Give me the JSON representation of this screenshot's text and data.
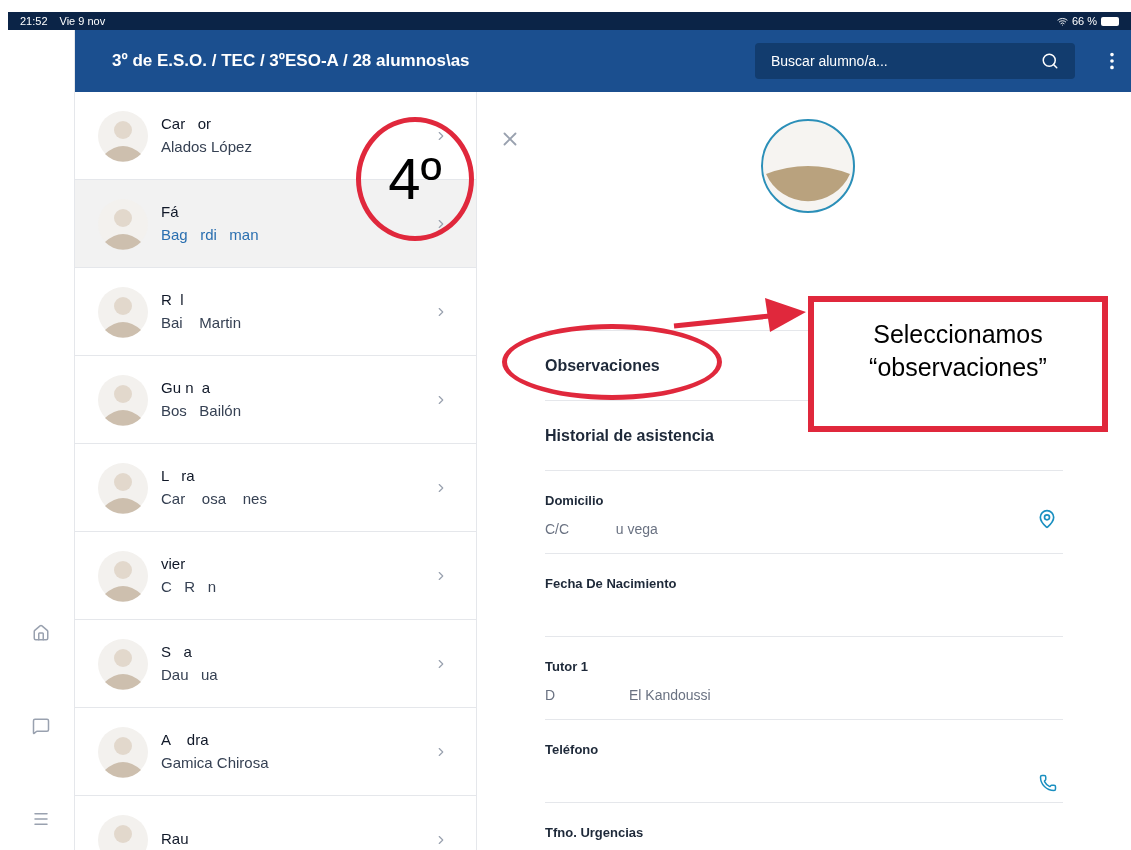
{
  "status_bar": {
    "time": "21:52",
    "date": "Vie 9 nov",
    "battery": "66 %"
  },
  "header": {
    "title": "3º de E.S.O. / TEC / 3ºESO-A / 28 alumnos\\as",
    "search": {
      "placeholder": "Buscar alumno/a..."
    }
  },
  "students": [
    {
      "first": "Car   or",
      "last": "Alados López",
      "selected": false
    },
    {
      "first": "Fá",
      "last": "Bag   rdi   man",
      "selected": true
    },
    {
      "first": "R  l",
      "last": "Bai    Martin",
      "selected": false
    },
    {
      "first": "Gu n  a",
      "last": "Bos   Bailón",
      "selected": false
    },
    {
      "first": "L   ra",
      "last": "Car    osa    nes",
      "selected": false
    },
    {
      "first": "vier",
      "last": "C   R   n",
      "selected": false
    },
    {
      "first": "S   a",
      "last": "Dau   ua",
      "selected": false
    },
    {
      "first": "A    dra",
      "last": "Gamica Chirosa",
      "selected": false
    },
    {
      "first": "Rau",
      "selected": false
    }
  ],
  "detail": {
    "items": [
      {
        "kind": "link",
        "label": "Observaciones"
      },
      {
        "kind": "link",
        "label": "Historial de asistencia"
      },
      {
        "kind": "address",
        "label": "Domicilio",
        "value": "C/C            u vega"
      },
      {
        "kind": "field",
        "label": "Fecha De Nacimiento"
      },
      {
        "kind": "field",
        "label": "Tutor 1",
        "value": "D                   El Kandoussi"
      },
      {
        "kind": "phone",
        "label": "Teléfono"
      },
      {
        "kind": "phone",
        "label": "Tfno. Urgencias"
      }
    ]
  },
  "annotations": {
    "number": "4º",
    "callout": "Seleccionamos “observaciones”"
  }
}
